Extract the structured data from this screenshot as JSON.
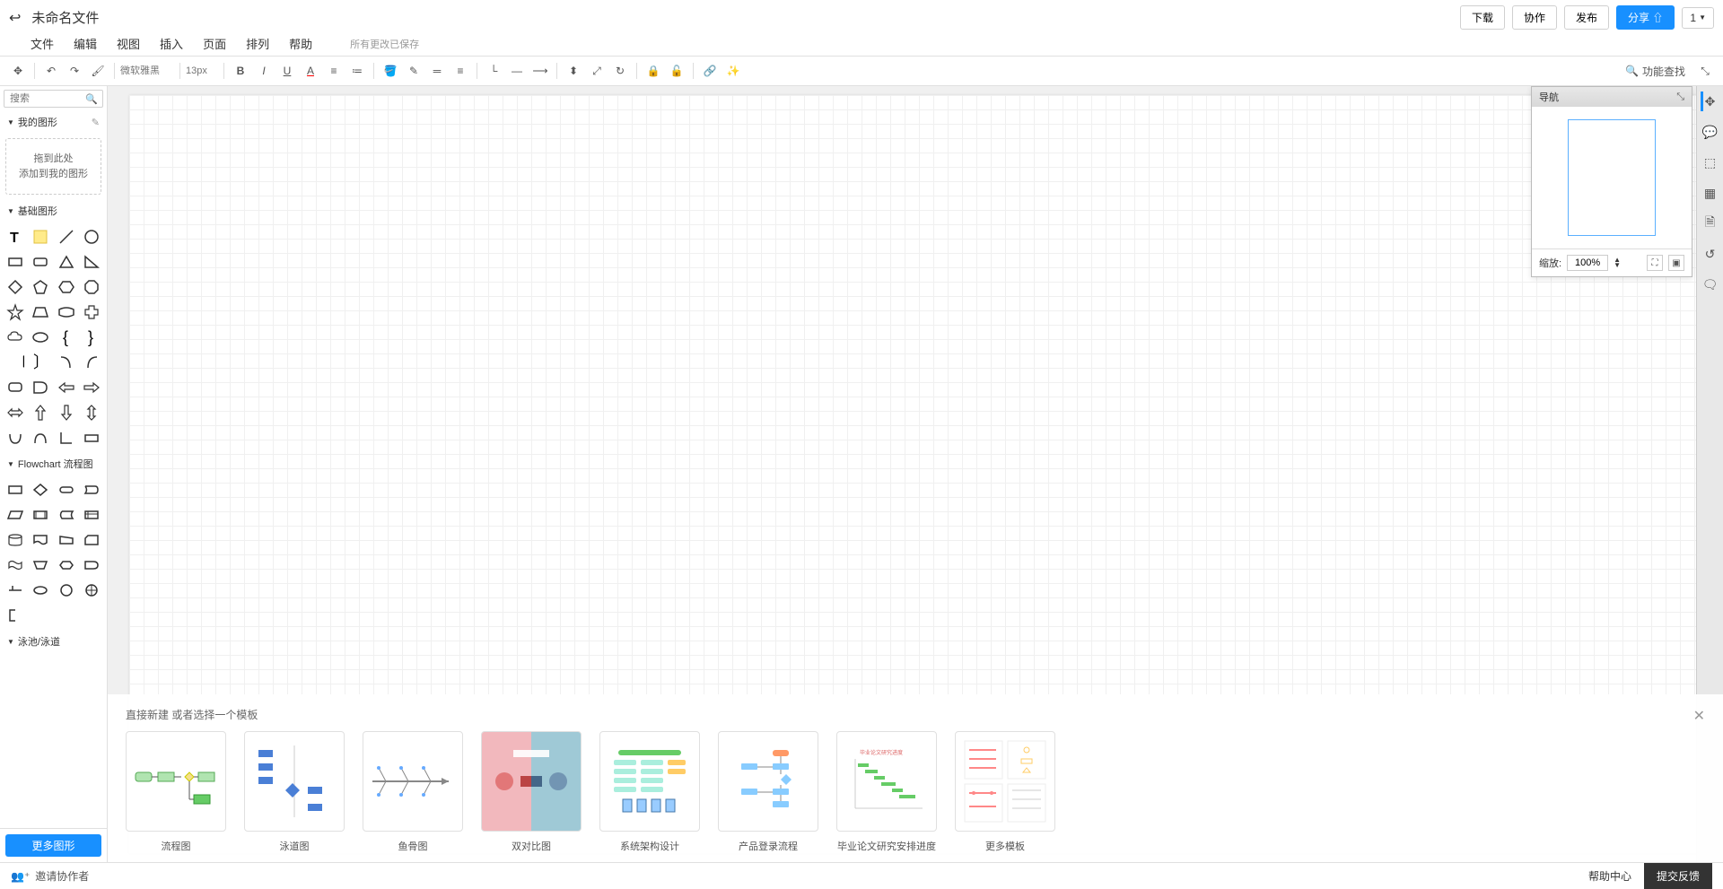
{
  "header": {
    "doc_title": "未命名文件",
    "buttons": {
      "download": "下载",
      "collab": "协作",
      "publish": "发布",
      "share": "分享 ⇧"
    },
    "user_count": "1"
  },
  "menu": {
    "file": "文件",
    "edit": "编辑",
    "view": "视图",
    "insert": "插入",
    "page": "页面",
    "arrange": "排列",
    "help": "帮助",
    "save_status": "所有更改已保存"
  },
  "toolbar": {
    "font_family": "微软雅黑",
    "font_size": "13px",
    "feature_search": "功能查找"
  },
  "sidebar": {
    "search_placeholder": "搜索",
    "my_shapes": "我的图形",
    "drop_zone_line1": "拖到此处",
    "drop_zone_line2": "添加到我的图形",
    "basic_shapes": "基础图形",
    "flowchart": "Flowchart 流程图",
    "swimlane": "泳池/泳道",
    "more_shapes": "更多图形"
  },
  "nav_panel": {
    "title": "导航",
    "zoom_label": "缩放:",
    "zoom_value": "100%"
  },
  "templates": {
    "title": "直接新建 或者选择一个模板",
    "items": [
      {
        "label": "流程图"
      },
      {
        "label": "泳道图"
      },
      {
        "label": "鱼骨图"
      },
      {
        "label": "双对比图"
      },
      {
        "label": "系统架构设计"
      },
      {
        "label": "产品登录流程"
      },
      {
        "label": "毕业论文研究安排进度"
      },
      {
        "label": "更多模板"
      }
    ]
  },
  "footer": {
    "invite": "邀请协作者",
    "help_center": "帮助中心",
    "feedback": "提交反馈"
  }
}
